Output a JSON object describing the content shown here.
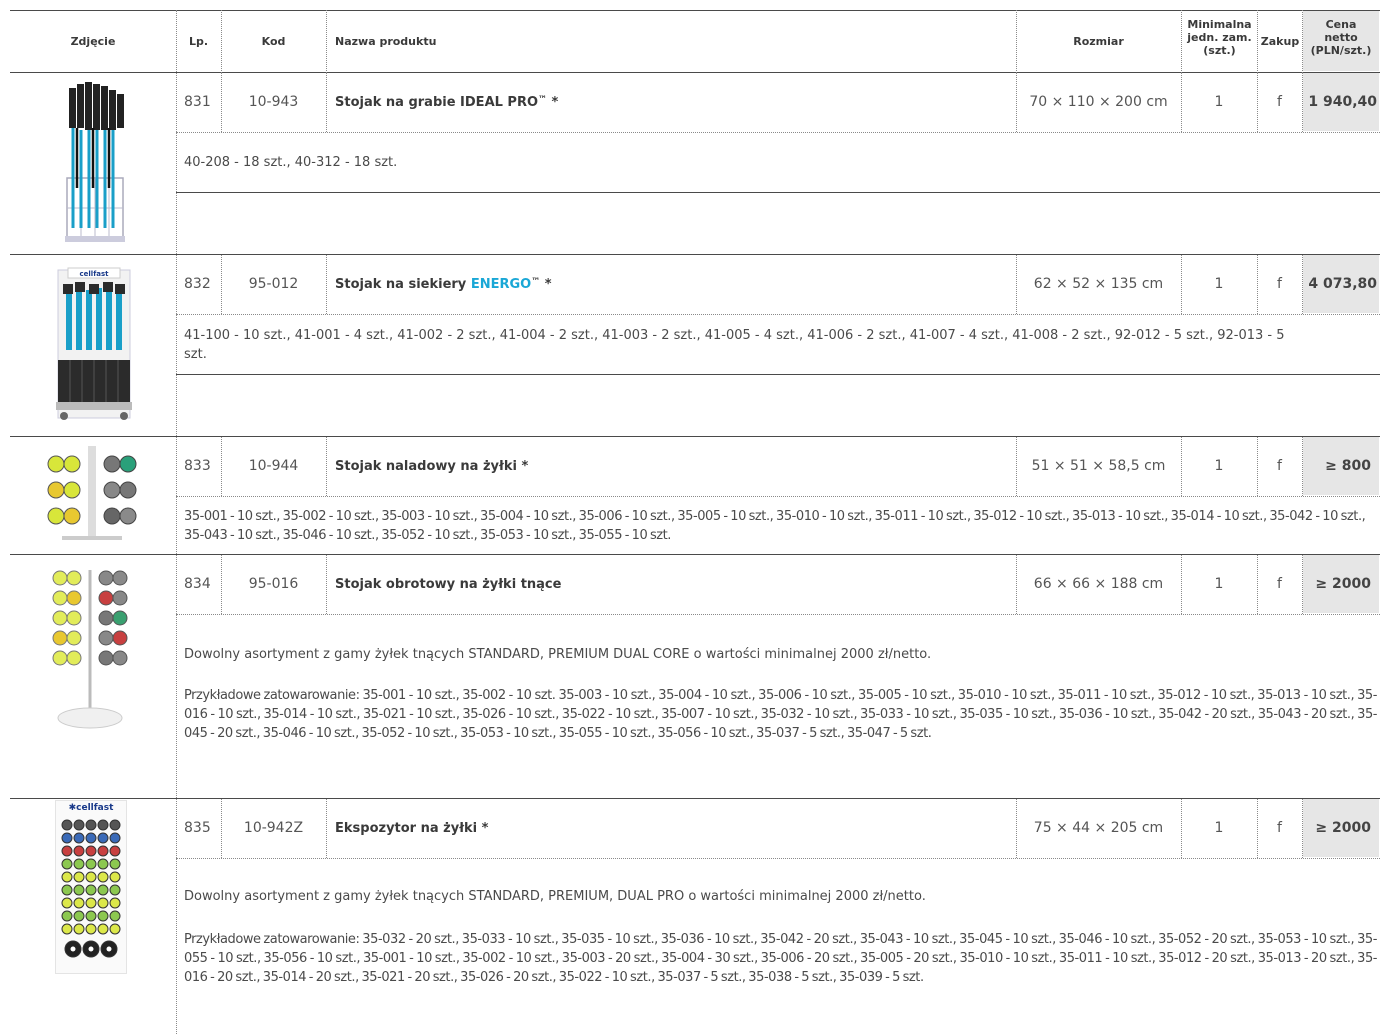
{
  "table": {
    "headers": {
      "photo": "Zdjęcie",
      "lp": "Lp.",
      "code": "Kod",
      "name": "Nazwa produktu",
      "size": "Rozmiar",
      "min_qty_l1": "Minimalna",
      "min_qty_l2": "jedn. zam.",
      "min_qty_l3": "(szt.)",
      "purchase": "Zakup",
      "price_l1": "Cena",
      "price_l2": "netto",
      "price_l3": "(PLN/szt.)"
    },
    "rows": [
      {
        "lp": "831",
        "code": "10-943",
        "name": "Stojak na grabie IDEAL PRO",
        "name_tm": "™",
        "name_suffix": " *",
        "size": "70 × 110 × 200 cm",
        "min_qty": "1",
        "purchase": "f",
        "price": "1 940,40",
        "desc": "40-208 - 18 szt., 40-312 - 18 szt."
      },
      {
        "lp": "832",
        "code": "95-012",
        "name": "Stojak na siekiery ",
        "name_brand": "ENERGO",
        "name_tm": "™",
        "name_suffix": " *",
        "size": "62 × 52 × 135 cm",
        "min_qty": "1",
        "purchase": "f",
        "price": "4 073,80",
        "desc": "41-100 - 10 szt., 41-001 - 4 szt., 41-002 - 2 szt., 41-004 - 2 szt., 41-003 - 2 szt., 41-005 - 4 szt., 41-006 - 2 szt., 41-007 - 4 szt., 41-008 - 2 szt., 92-012 - 5 szt., 92-013 - 5 szt."
      },
      {
        "lp": "833",
        "code": "10-944",
        "name": "Stojak naladowy na żyłki",
        "name_suffix": " *",
        "size": "51 × 51 × 58,5 cm",
        "min_qty": "1",
        "purchase": "f",
        "price": "≥ 800",
        "desc": "35-001 - 10 szt., 35-002 - 10 szt., 35-003 - 10 szt., 35-004 - 10 szt., 35-006 - 10 szt., 35-005 - 10 szt., 35-010 - 10 szt., 35-011 - 10 szt., 35-012 - 10 szt., 35-013 - 10 szt., 35-014 - 10 szt., 35-042 - 10 szt., 35-043 - 10 szt., 35-046 - 10 szt., 35-052 - 10 szt., 35-053 - 10 szt., 35-055 - 10 szt."
      },
      {
        "lp": "834",
        "code": "95-016",
        "name": "Stojak obrotowy na żyłki tnące",
        "name_suffix": "",
        "size": "66 × 66 × 188 cm",
        "min_qty": "1",
        "purchase": "f",
        "price": "≥ 2000",
        "desc": "Dowolny asortyment z gamy żyłek tnących STANDARD, PREMIUM DUAL CORE o wartości minimalnej 2000 zł/netto.",
        "desc2": "Przykładowe zatowarowanie: 35-001 - 10 szt., 35-002 - 10 szt. 35-003 - 10 szt., 35-004 - 10 szt., 35-006 - 10 szt., 35-005 - 10 szt., 35-010 - 10 szt., 35-011 - 10 szt., 35-012 - 10 szt., 35-013 - 10 szt., 35-016 - 10 szt., 35-014 - 10 szt., 35-021 - 10 szt., 35-026 - 10 szt., 35-022 - 10 szt., 35-007 - 10 szt., 35-032 - 10 szt., 35-033 - 10 szt., 35-035 - 10 szt., 35-036 - 10 szt., 35-042 - 20 szt., 35-043 - 20 szt., 35-045 - 20 szt., 35-046 - 10 szt., 35-052 - 10 szt., 35-053 - 10 szt., 35-055 - 10 szt., 35-056 - 10 szt., 35-037 - 5 szt., 35-047 - 5 szt."
      },
      {
        "lp": "835",
        "code": "10-942Z",
        "name": "Ekspozytor na żyłki",
        "name_suffix": " *",
        "size": "75 × 44 × 205 cm",
        "min_qty": "1",
        "purchase": "f",
        "price": "≥ 2000",
        "logo_text": "cellfast",
        "desc": "Dowolny asortyment z gamy żyłek tnących STANDARD, PREMIUM, DUAL PRO o wartości minimalnej 2000 zł/netto.",
        "desc2": "Przykładowe zatowarowanie: 35-032 - 20 szt., 35-033 - 10 szt., 35-035 - 10 szt., 35-036 - 10 szt., 35-042 - 20 szt., 35-043 - 10 szt., 35-045 - 10 szt., 35-046 - 10 szt., 35-052 - 20 szt., 35-053 - 10 szt., 35-055 - 10 szt., 35-056 - 10 szt., 35-001 - 10 szt., 35-002 - 10 szt., 35-003 - 20 szt., 35-004 - 30 szt., 35-006 - 20 szt., 35-005 - 20 szt., 35-010 - 10 szt., 35-011 - 10 szt., 35-012 - 20 szt., 35-013 - 20 szt., 35-016 - 20 szt., 35-014 - 20 szt., 35-021 - 20 szt., 35-026 - 20 szt., 35-022 - 10 szt., 35-037 - 5 szt., 35-038 - 5 szt., 35-039 - 5 szt."
      }
    ]
  },
  "colors": {
    "price_column_bg": "#e6e6e6",
    "brand_blue": "#1aa7d6",
    "text": "#3c3c3c"
  }
}
